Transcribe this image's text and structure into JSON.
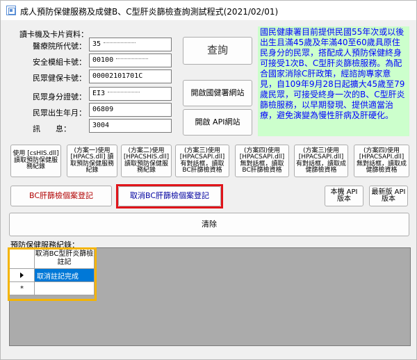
{
  "window": {
    "title": "成人預防保健服務及成健B、C型肝炎篩檢查詢測試程式(2021/02/01)"
  },
  "card": {
    "section_label": "讀卡機及卡片資料：",
    "fields": [
      {
        "label": "醫療院所代號：",
        "value": "35"
      },
      {
        "label": "安全模組卡號：",
        "value": "00100"
      },
      {
        "label": "民眾健保卡號：",
        "value": "00002101701C"
      },
      {
        "label": "民眾身分證號：",
        "value": "EI3"
      },
      {
        "label": "民眾出生年月：",
        "value": "06809"
      },
      {
        "label": "訊　　息：",
        "value": "3004"
      }
    ]
  },
  "buttons": {
    "query": "查詢",
    "open_nhi_site": "開啟國健署網站",
    "open_api_site": "開啟 API網站",
    "bc_register": "BC肝篩檢個案登記",
    "cancel_bc_register": "取消BC肝篩檢個案登記",
    "local_api_version": "本機 API 版本",
    "latest_api_version": "最新版 API 版本",
    "clear": "清除"
  },
  "method_buttons": [
    "使用 [csHIS.dll] 讀取預防保健服務紀錄",
    "(方案一)使用 [HPACS.dll] 讀取預防保健服務紀錄",
    "(方案二)使用 [HPACSHIS.dll] 讀取預防保健服務紀錄",
    "(方案三)使用 [HPACSAPI.dll] 有對話框，讀取BC肝篩檢資格",
    "(方案四)使用 [HPACSAPI.dll] 無對話框，讀取BC肝篩檢資格",
    "(方案三)使用 [HPACSAPI.dll] 有對話框，讀取成健篩檢資格",
    "(方案四)使用 [HPACSAPI.dll] 無對話框，讀取成健篩檢資格"
  ],
  "notice": "國民健康署目前提供民國55年次或以後出生且滿45歲及年滿40至60歲具原住民身分的民眾，搭配成人預防保健終身可接受1次B、C型肝炎篩檢服務。為配合國家消除C肝政策，經諮詢專家意見，自109年9月28日起擴大45歲至79歲民眾，可接受終身一次的B、C型肝炎篩檢服務，以早期發現、提供適當治療，避免演變為慢性肝病及肝硬化。",
  "records": {
    "section_label": "預防保健服務紀錄：",
    "column_header": "取消BC型肝炎篩檢註記",
    "rows": [
      "取消註記完成"
    ],
    "new_row_marker": "*"
  }
}
